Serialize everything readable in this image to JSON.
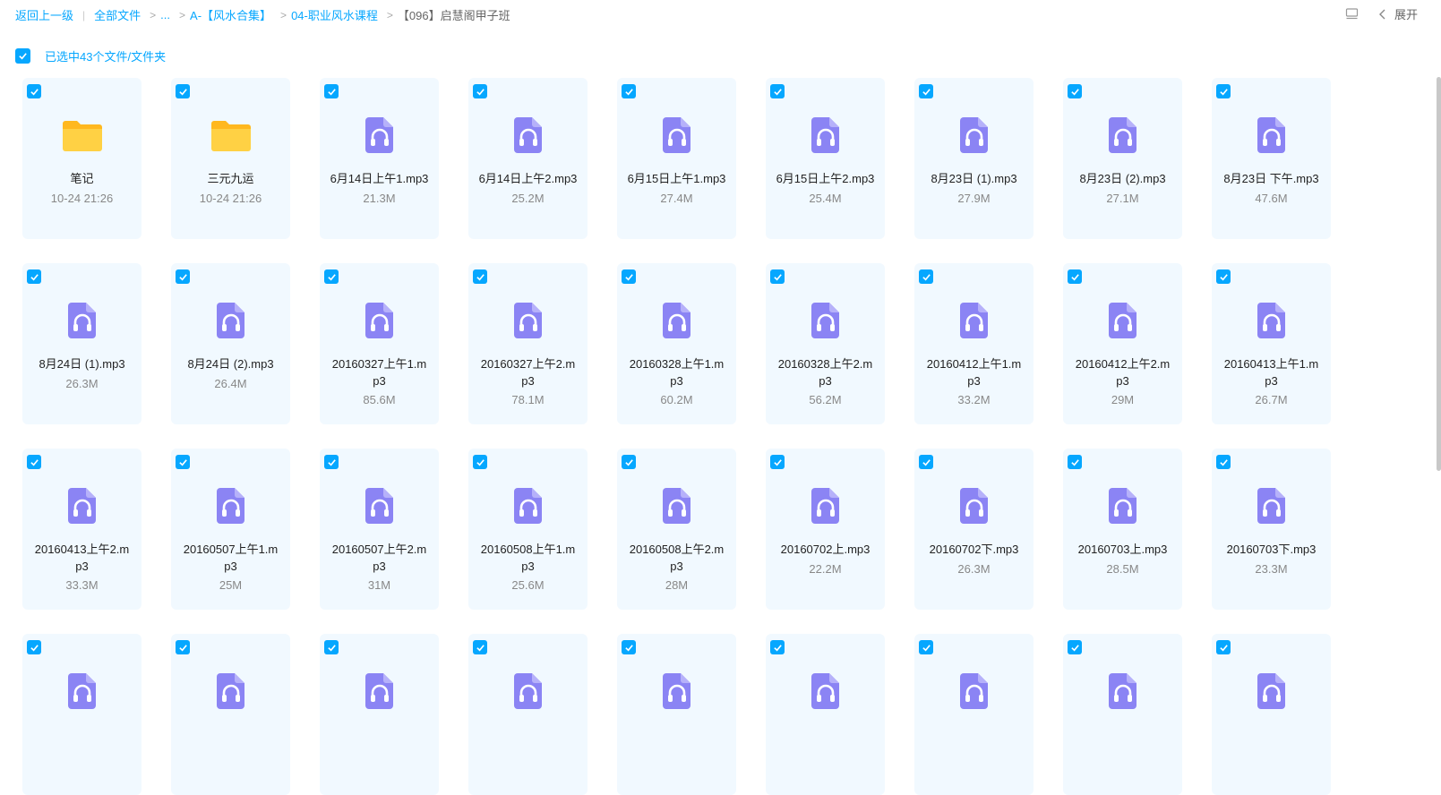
{
  "breadcrumb": {
    "back": "返回上一级",
    "items": [
      "全部文件",
      "...",
      "A-【风水合集】",
      "04-职业风水课程"
    ],
    "current": "【096】启慧阁甲子班"
  },
  "toolbar": {
    "expand_label": "展开"
  },
  "selection": {
    "label": "已选中43个文件/文件夹"
  },
  "files": [
    {
      "name": "笔记",
      "meta": "10-24 21:26",
      "type": "folder"
    },
    {
      "name": "三元九运",
      "meta": "10-24 21:26",
      "type": "folder"
    },
    {
      "name": "6月14日上午1.mp3",
      "meta": "21.3M",
      "type": "audio"
    },
    {
      "name": "6月14日上午2.mp3",
      "meta": "25.2M",
      "type": "audio"
    },
    {
      "name": "6月15日上午1.mp3",
      "meta": "27.4M",
      "type": "audio"
    },
    {
      "name": "6月15日上午2.mp3",
      "meta": "25.4M",
      "type": "audio"
    },
    {
      "name": "8月23日 (1).mp3",
      "meta": "27.9M",
      "type": "audio"
    },
    {
      "name": "8月23日 (2).mp3",
      "meta": "27.1M",
      "type": "audio"
    },
    {
      "name": "8月23日 下午.mp3",
      "meta": "47.6M",
      "type": "audio"
    },
    {
      "name": "8月24日 (1).mp3",
      "meta": "26.3M",
      "type": "audio"
    },
    {
      "name": "8月24日 (2).mp3",
      "meta": "26.4M",
      "type": "audio"
    },
    {
      "name": "20160327上午1.mp3",
      "meta": "85.6M",
      "type": "audio"
    },
    {
      "name": "20160327上午2.mp3",
      "meta": "78.1M",
      "type": "audio"
    },
    {
      "name": "20160328上午1.mp3",
      "meta": "60.2M",
      "type": "audio"
    },
    {
      "name": "20160328上午2.mp3",
      "meta": "56.2M",
      "type": "audio"
    },
    {
      "name": "20160412上午1.mp3",
      "meta": "33.2M",
      "type": "audio"
    },
    {
      "name": "20160412上午2.mp3",
      "meta": "29M",
      "type": "audio"
    },
    {
      "name": "20160413上午1.mp3",
      "meta": "26.7M",
      "type": "audio"
    },
    {
      "name": "20160413上午2.mp3",
      "meta": "33.3M",
      "type": "audio"
    },
    {
      "name": "20160507上午1.mp3",
      "meta": "25M",
      "type": "audio"
    },
    {
      "name": "20160507上午2.mp3",
      "meta": "31M",
      "type": "audio"
    },
    {
      "name": "20160508上午1.mp3",
      "meta": "25.6M",
      "type": "audio"
    },
    {
      "name": "20160508上午2.mp3",
      "meta": "28M",
      "type": "audio"
    },
    {
      "name": "20160702上.mp3",
      "meta": "22.2M",
      "type": "audio"
    },
    {
      "name": "20160702下.mp3",
      "meta": "26.3M",
      "type": "audio"
    },
    {
      "name": "20160703上.mp3",
      "meta": "28.5M",
      "type": "audio"
    },
    {
      "name": "20160703下.mp3",
      "meta": "23.3M",
      "type": "audio"
    },
    {
      "name": "",
      "meta": "",
      "type": "audio"
    },
    {
      "name": "",
      "meta": "",
      "type": "audio"
    },
    {
      "name": "",
      "meta": "",
      "type": "audio"
    },
    {
      "name": "",
      "meta": "",
      "type": "audio"
    },
    {
      "name": "",
      "meta": "",
      "type": "audio"
    },
    {
      "name": "",
      "meta": "",
      "type": "audio"
    },
    {
      "name": "",
      "meta": "",
      "type": "audio"
    },
    {
      "name": "",
      "meta": "",
      "type": "audio"
    },
    {
      "name": "",
      "meta": "",
      "type": "audio"
    }
  ],
  "colors": {
    "accent": "#06a7ff",
    "card_bg": "#f1f9ff",
    "audio_icon": "#8b84f4",
    "folder": "#ffc933"
  }
}
